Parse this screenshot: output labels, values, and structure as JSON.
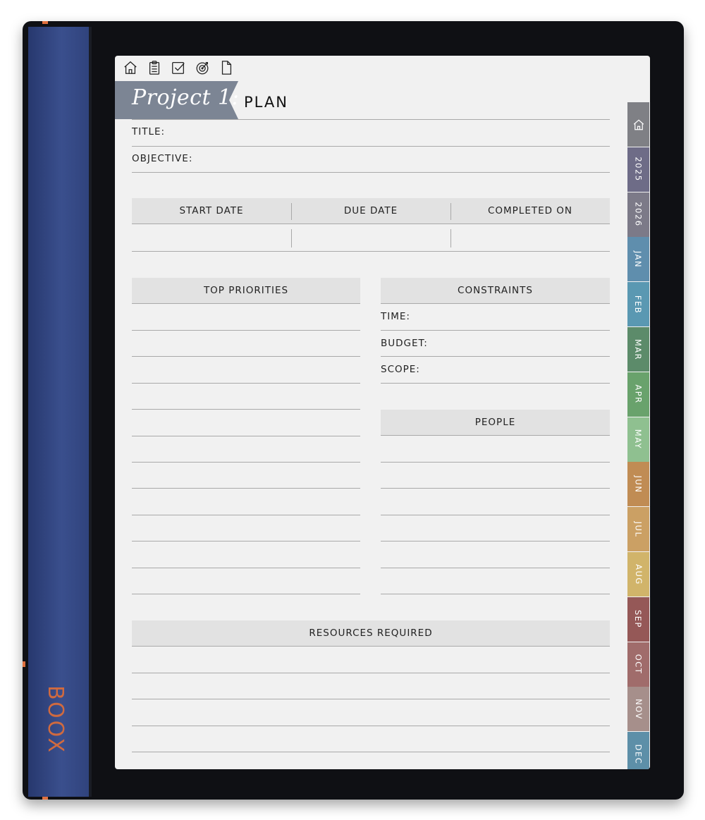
{
  "device": {
    "brand": "BOOX"
  },
  "toolbar": {
    "icons": [
      "home-icon",
      "clipboard-icon",
      "checkbox-icon",
      "target-icon",
      "page-icon"
    ]
  },
  "header": {
    "project_title": "Project 1:",
    "page_heading": "PLAN"
  },
  "fields": {
    "title": "TITLE:",
    "objective": "OBJECTIVE:"
  },
  "dates": {
    "start": "START DATE",
    "due": "DUE DATE",
    "completed": "COMPLETED ON"
  },
  "sections": {
    "top_priorities": "TOP PRIORITIES",
    "constraints": "CONSTRAINTS",
    "people": "PEOPLE",
    "resources": "RESOURCES REQUIRED"
  },
  "constraints": {
    "time": "TIME:",
    "budget": "BUDGET:",
    "scope": "SCOPE:"
  },
  "tabs": [
    {
      "label": "home-icon",
      "color": "#7f8085"
    },
    {
      "label": "2025",
      "color": "#6e6c87"
    },
    {
      "label": "2026",
      "color": "#7c7a88"
    },
    {
      "label": "JAN",
      "color": "#5f8ead"
    },
    {
      "label": "FEB",
      "color": "#5a98b2"
    },
    {
      "label": "MAR",
      "color": "#5c8b6a"
    },
    {
      "label": "APR",
      "color": "#69a26c"
    },
    {
      "label": "MAY",
      "color": "#8fc090"
    },
    {
      "label": "JUN",
      "color": "#c08c54"
    },
    {
      "label": "JUL",
      "color": "#cba064"
    },
    {
      "label": "AUG",
      "color": "#d1b46a"
    },
    {
      "label": "SEP",
      "color": "#955857"
    },
    {
      "label": "OCT",
      "color": "#a06c6b"
    },
    {
      "label": "NOV",
      "color": "#a68f8b"
    },
    {
      "label": "DEC",
      "color": "#5d8fa8"
    }
  ],
  "colors": {
    "banner": "#7c8594",
    "brand": "#d06a3f",
    "header_fill": "#e2e2e2"
  }
}
